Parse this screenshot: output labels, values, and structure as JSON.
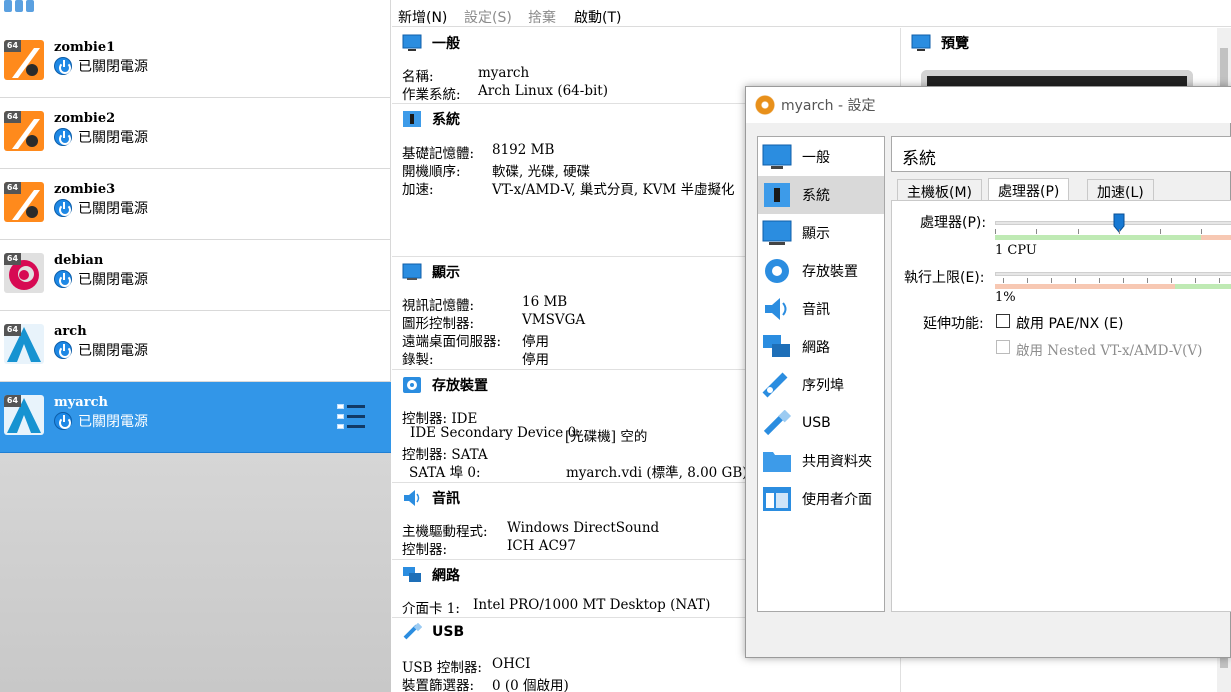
{
  "toolbar": {
    "new_label": "新增(N)",
    "settings_label": "設定(S)",
    "discard_label": "捨棄",
    "start_label": "啟動(T)"
  },
  "vms": [
    {
      "name": "zombie1",
      "state": "已關閉電源",
      "os_icon": "arch-ubuntu-icon",
      "arch_badge": "64"
    },
    {
      "name": "zombie2",
      "state": "已關閉電源",
      "os_icon": "ubuntu-icon",
      "arch_badge": "64"
    },
    {
      "name": "zombie3",
      "state": "已關閉電源",
      "os_icon": "ubuntu-icon",
      "arch_badge": "64"
    },
    {
      "name": "debian",
      "state": "已關閉電源",
      "os_icon": "debian-icon",
      "arch_badge": "64"
    },
    {
      "name": "arch",
      "state": "已關閉電源",
      "os_icon": "arch-linux-icon",
      "arch_badge": "64"
    },
    {
      "name": "myarch",
      "state": "已關閉電源",
      "os_icon": "arch-linux-icon",
      "arch_badge": "64"
    }
  ],
  "details": {
    "general": {
      "title": "一般",
      "name_label": "名稱:",
      "name_value": "myarch",
      "os_label": "作業系統:",
      "os_value": "Arch Linux (64-bit)"
    },
    "system": {
      "title": "系統",
      "mem_label": "基礎記憶體:",
      "mem_value": "8192 MB",
      "boot_label": "開機順序:",
      "boot_value": "軟碟, 光碟, 硬碟",
      "accel_label": "加速:",
      "accel_value": "VT-x/AMD-V, 巢式分頁, KVM 半虛擬化"
    },
    "display": {
      "title": "顯示",
      "vram_label": "視訊記憶體:",
      "vram_value": "16 MB",
      "gfx_label": "圖形控制器:",
      "gfx_value": "VMSVGA",
      "rdp_label": "遠端桌面伺服器:",
      "rdp_value": "停用",
      "rec_label": "錄製:",
      "rec_value": "停用"
    },
    "storage": {
      "title": "存放裝置",
      "ctrl1": "控制器: IDE",
      "ide_dev_label": "IDE Secondary Device 0:",
      "ide_dev_value": "[光碟機] 空的",
      "ctrl2": "控制器: SATA",
      "sata_label": "SATA 埠 0:",
      "sata_value": "myarch.vdi (標準, 8.00 GB)"
    },
    "audio": {
      "title": "音訊",
      "host_label": "主機驅動程式:",
      "host_value": "Windows DirectSound",
      "ctrl_label": "控制器:",
      "ctrl_value": "ICH AC97"
    },
    "network": {
      "title": "網路",
      "nic_label": "介面卡 1:",
      "nic_value": "Intel PRO/1000 MT Desktop (NAT)"
    },
    "usb": {
      "title": "USB",
      "ctrl_label": "USB 控制器:",
      "ctrl_value": "OHCI",
      "filter_label": "裝置篩選器:",
      "filter_value": "0 (0 個啟用)"
    }
  },
  "preview": {
    "title": "預覽"
  },
  "dialog": {
    "title": "myarch - 設定",
    "categories": [
      "一般",
      "系統",
      "顯示",
      "存放裝置",
      "音訊",
      "網路",
      "序列埠",
      "USB",
      "共用資料夾",
      "使用者介面"
    ],
    "selected_category": "系統",
    "page_title": "系統",
    "tabs": [
      "主機板(M)",
      "處理器(P)",
      "加速(L)"
    ],
    "active_tab": "處理器(P)",
    "processor_label": "處理器(P):",
    "processor_min": "1 CPU",
    "cap_label": "執行上限(E):",
    "cap_min": "1%",
    "ext_label": "延伸功能:",
    "pae_label": "啟用 PAE/NX (E)",
    "pae_checked": false,
    "nested_label": "啟用 Nested VT-x/AMD-V(V)",
    "nested_checked": false,
    "nested_enabled": false
  }
}
